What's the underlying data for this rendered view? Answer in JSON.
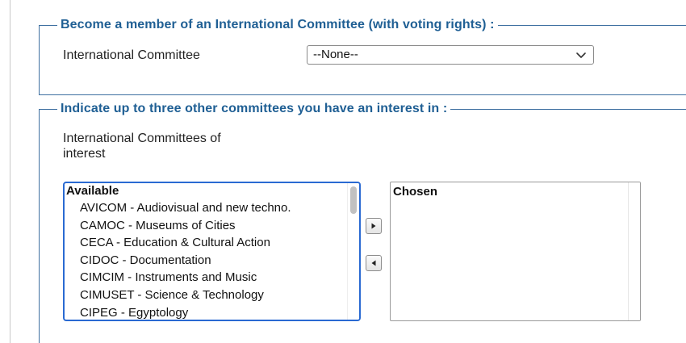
{
  "membership": {
    "legend": "Become a member of an International Committee (with voting rights) :",
    "field_label": "International Committee",
    "selected_value": "--None--"
  },
  "interests": {
    "legend": "Indicate up to three other committees you have an interest in :",
    "field_label_line1": "International Committees of",
    "field_label_line2": "interest",
    "available": {
      "header": "Available",
      "items": [
        "AVICOM - Audiovisual and new techno.",
        "CAMOC - Museums of Cities",
        "CECA - Education & Cultural Action",
        "CIDOC - Documentation",
        "CIMCIM - Instruments and Music",
        "CIMUSET - Science & Technology",
        "CIPEG - Egyptology"
      ]
    },
    "chosen": {
      "header": "Chosen",
      "items": []
    },
    "buttons": {
      "add_icon": "triangle-right-icon",
      "remove_icon": "triangle-left-icon"
    }
  },
  "colors": {
    "legend_text": "#1f5f94",
    "fieldset_border": "#3d6fa0",
    "focus_border": "#2a6ad2"
  }
}
